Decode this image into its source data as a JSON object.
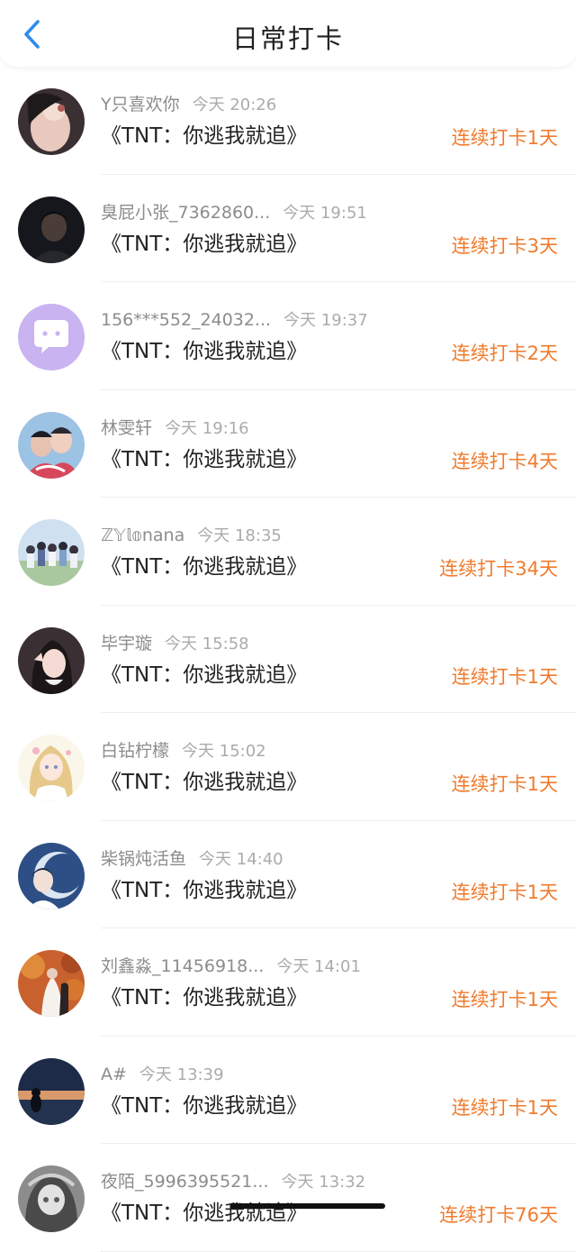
{
  "header": {
    "title": "日常打卡",
    "back_icon": "chevron-left-icon",
    "accent_color": "#2f8cf0"
  },
  "colors": {
    "streak": "#f07b2d",
    "name": "#8c8c8c",
    "title_text": "#222222"
  },
  "checkins": [
    {
      "name": "Y只喜欢你",
      "time": "今天 20:26",
      "book": "《TNT：你逃我就追》",
      "streak": "连续打卡1天",
      "avatar": "photo-dark-hand"
    },
    {
      "name": "臭屁小张_7362860...",
      "time": "今天 19:51",
      "book": "《TNT：你逃我就追》",
      "streak": "连续打卡3天",
      "avatar": "photo-dark-portrait"
    },
    {
      "name": "156***552_24032...",
      "time": "今天 19:37",
      "book": "《TNT：你逃我就追》",
      "streak": "连续打卡2天",
      "avatar": "default-chat-avatar"
    },
    {
      "name": "林雯轩",
      "time": "今天 19:16",
      "book": "《TNT：你逃我就追》",
      "streak": "连续打卡4天",
      "avatar": "photo-couple"
    },
    {
      "name": "ℤ𝕐𝕝𝕠nana",
      "time": "今天 18:35",
      "book": "《TNT：你逃我就追》",
      "streak": "连续打卡34天",
      "avatar": "photo-group"
    },
    {
      "name": "毕宇璇",
      "time": "今天 15:58",
      "book": "《TNT：你逃我就追》",
      "streak": "连续打卡1天",
      "avatar": "photo-girl-peace"
    },
    {
      "name": "白钻柠檬",
      "time": "今天 15:02",
      "book": "《TNT：你逃我就追》",
      "streak": "连续打卡1天",
      "avatar": "anime-girl-light"
    },
    {
      "name": "柴锅炖活鱼",
      "time": "今天 14:40",
      "book": "《TNT：你逃我就追》",
      "streak": "连续打卡1天",
      "avatar": "anime-moon-blue"
    },
    {
      "name": "刘鑫淼_11456918...",
      "time": "今天 14:01",
      "book": "《TNT：你逃我就追》",
      "streak": "连续打卡1天",
      "avatar": "photo-autumn-wedding"
    },
    {
      "name": "A#",
      "time": "今天 13:39",
      "book": "《TNT：你逃我就追》",
      "streak": "连续打卡1天",
      "avatar": "photo-sunset-sea"
    },
    {
      "name": "夜陌_5996395521...",
      "time": "今天 13:32",
      "book": "《TNT：你逃我就追》",
      "streak": "连续打卡76天",
      "avatar": "anime-grey-girl"
    }
  ]
}
